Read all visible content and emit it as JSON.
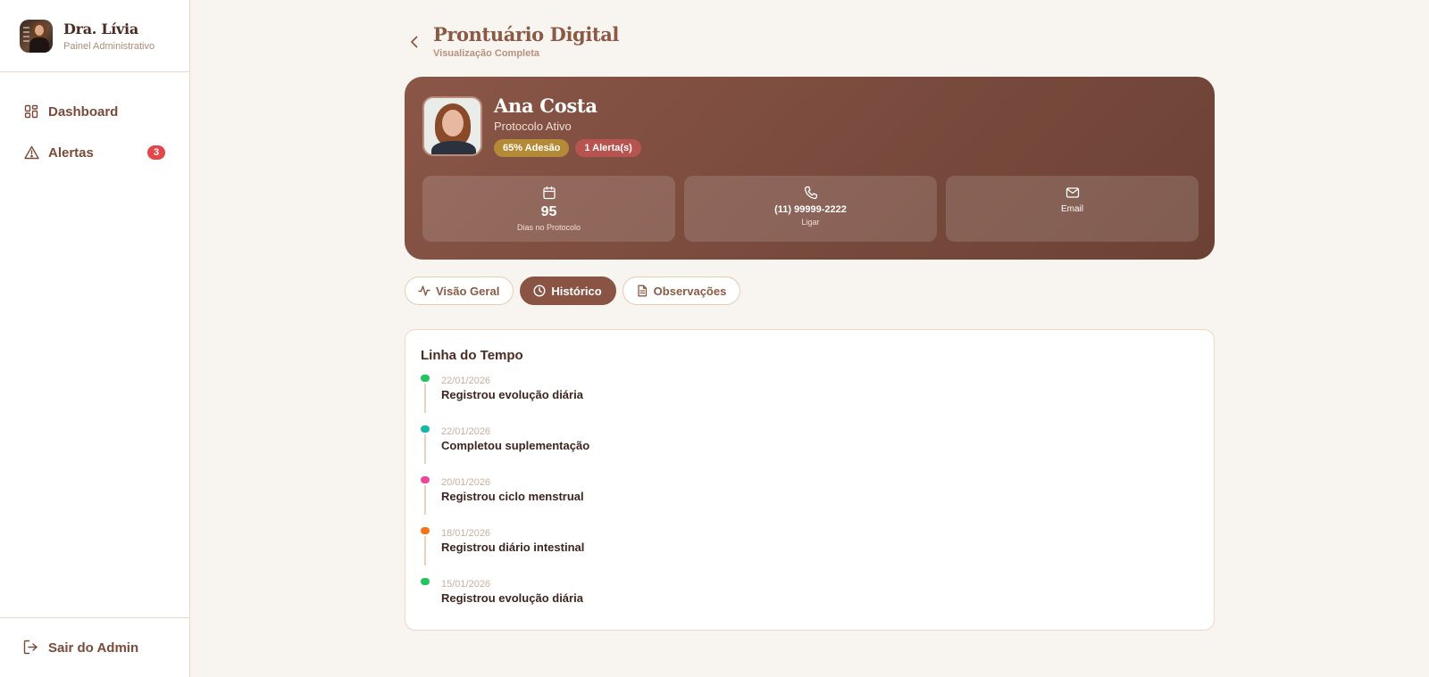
{
  "sidebar": {
    "doctor_name": "Dra. Lívia",
    "doctor_subtitle": "Painel Administrativo",
    "nav": [
      {
        "label": "Dashboard",
        "icon": "dashboard-grid-icon"
      },
      {
        "label": "Alertas",
        "icon": "warning-triangle-icon",
        "badge": "3"
      }
    ],
    "logout_label": "Sair do Admin"
  },
  "header": {
    "title": "Prontuário Digital",
    "subtitle": "Visualização Completa"
  },
  "patient": {
    "name": "Ana Costa",
    "status": "Protocolo Ativo",
    "adherence_badge": "65% Adesão",
    "alerts_badge": "1 Alerta(s)",
    "stats": {
      "days_value": "95",
      "days_label": "Dias no Protocolo",
      "phone_value": "(11) 99999-2222",
      "phone_label": "Ligar",
      "email_label": "Email"
    }
  },
  "tabs": [
    {
      "label": "Visão Geral",
      "icon": "activity-icon",
      "active": false
    },
    {
      "label": "Histórico",
      "icon": "clock-icon",
      "active": true
    },
    {
      "label": "Observações",
      "icon": "document-icon",
      "active": false
    }
  ],
  "timeline": {
    "title": "Linha do Tempo",
    "items": [
      {
        "date": "22/01/2026",
        "text": "Registrou evolução diária",
        "color": "#22c55e"
      },
      {
        "date": "22/01/2026",
        "text": "Completou suplementação",
        "color": "#14b8a6"
      },
      {
        "date": "20/01/2026",
        "text": "Registrou ciclo menstrual",
        "color": "#ec4899"
      },
      {
        "date": "18/01/2026",
        "text": "Registrou diário intestinal",
        "color": "#f97316"
      },
      {
        "date": "15/01/2026",
        "text": "Registrou evolução diária",
        "color": "#22c55e"
      }
    ]
  },
  "colors": {
    "accent": "#8a5445",
    "background": "#f8f4f0",
    "alert_red": "#e2484b"
  }
}
